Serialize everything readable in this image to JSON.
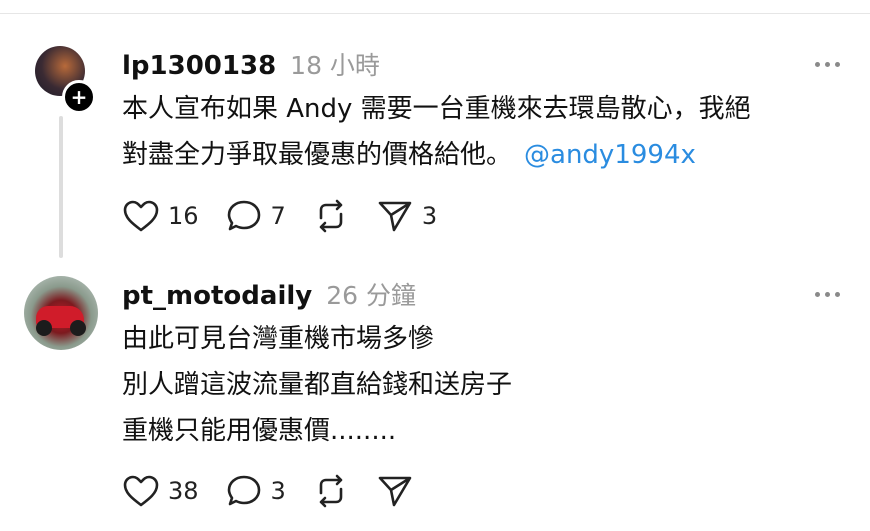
{
  "posts": [
    {
      "username": "lp1300138",
      "time": "18 小時",
      "lines": [
        "本人宣布如果 Andy 需要一台重機來去環島散心，我絕",
        "對盡全力爭取最優惠的價格給他。"
      ],
      "mention": "@andy1994x",
      "likes": "16",
      "replies": "7",
      "reposts": "",
      "shares": "3"
    },
    {
      "username": "pt_motodaily",
      "time": "26 分鐘",
      "lines": [
        "由此可見台灣重機市場多慘",
        "別人蹭這波流量都直給錢和送房子",
        "重機只能用優惠價........"
      ],
      "likes": "38",
      "replies": "3",
      "reposts": "",
      "shares": ""
    }
  ],
  "icons": {
    "like": "heart-icon",
    "reply": "comment-icon",
    "repost": "repost-icon",
    "share": "send-icon",
    "more": "more-icon",
    "follow": "plus-icon"
  },
  "colors": {
    "mention": "#2a8ce0",
    "meta": "#9a9a9a",
    "follow_badge": "#000000"
  },
  "follow_symbol": "+"
}
